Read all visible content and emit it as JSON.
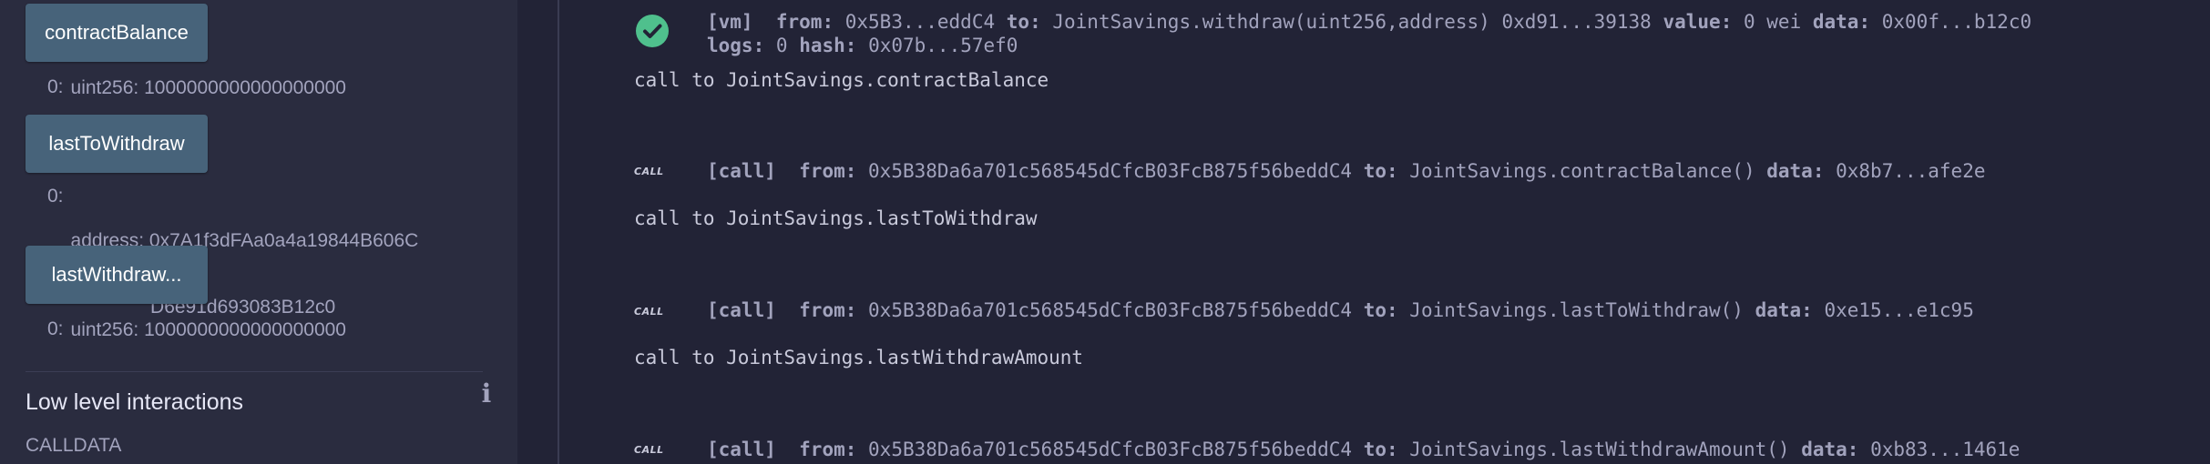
{
  "left": {
    "functions": [
      {
        "label": "contractBalance",
        "output_index": "0:",
        "output_lines": [
          "uint256: 1000000000000000000"
        ]
      },
      {
        "label": "lastToWithdraw",
        "output_index": "0:",
        "output_lines": [
          "address: 0x7A1f3dFAa0a4a19844B606C",
          "               D6e91d693083B12c0"
        ]
      },
      {
        "label": "lastWithdraw...",
        "output_index": "0:",
        "output_lines": [
          "uint256: 1000000000000000000"
        ]
      }
    ],
    "low_level_title": "Low level interactions",
    "info_icon": "i",
    "calldata_label": "CALLDATA"
  },
  "terminal": {
    "vm_tx": {
      "tag": "[vm]",
      "from_label": "from:",
      "from": "0x5B3...eddC4",
      "to_label": "to:",
      "to": "JointSavings.withdraw(uint256,address) 0xd91...39138",
      "value_label": "value:",
      "value": "0 wei",
      "data_label": "data:",
      "data": "0x00f...b12c0",
      "logs_label": "logs:",
      "logs": "0",
      "hash_label": "hash:",
      "hash": "0x07b...57ef0"
    },
    "call_badge": "CALL",
    "calls": [
      {
        "heading": "call to JointSavings.contractBalance",
        "tag": "[call]",
        "from_label": "from:",
        "from": "0x5B38Da6a701c568545dCfcB03FcB875f56beddC4",
        "to_label": "to:",
        "to": "JointSavings.contractBalance()",
        "data_label": "data:",
        "data": "0x8b7...afe2e"
      },
      {
        "heading": "call to JointSavings.lastToWithdraw",
        "tag": "[call]",
        "from_label": "from:",
        "from": "0x5B38Da6a701c568545dCfcB03FcB875f56beddC4",
        "to_label": "to:",
        "to": "JointSavings.lastToWithdraw()",
        "data_label": "data:",
        "data": "0xe15...e1c95"
      },
      {
        "heading": "call to JointSavings.lastWithdrawAmount",
        "tag": "[call]",
        "from_label": "from:",
        "from": "0x5B38Da6a701c568545dCfcB03FcB875f56beddC4",
        "to_label": "to:",
        "to": "JointSavings.lastWithdrawAmount()",
        "data_label": "data:",
        "data": "0xb83...1461e"
      }
    ]
  },
  "colors": {
    "background": "#222336",
    "panel": "#2a2c3f",
    "button": "#47637a",
    "success": "#4fc08d",
    "text": "#a2a3bd"
  }
}
